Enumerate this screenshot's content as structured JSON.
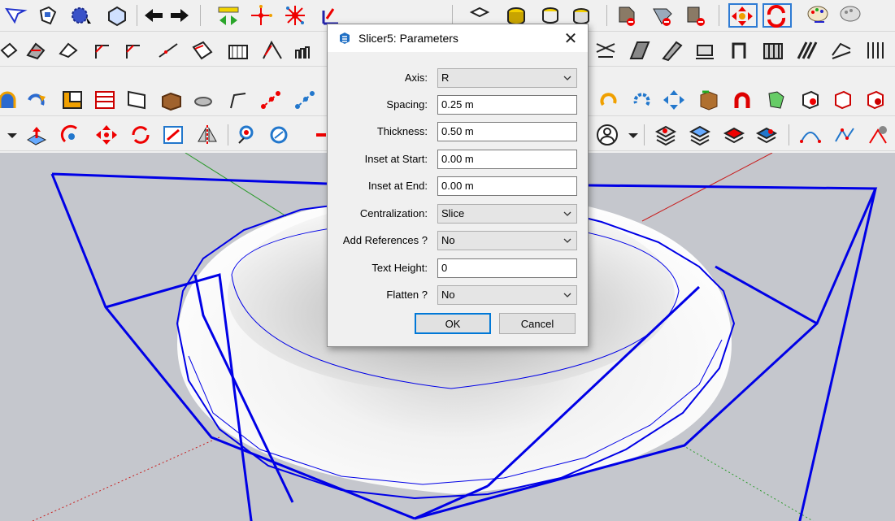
{
  "dialog": {
    "title": "Slicer5: Parameters",
    "close_glyph": "✕",
    "fields": {
      "axis": {
        "label": "Axis:",
        "value": "R"
      },
      "spacing": {
        "label": "Spacing:",
        "value": "0.25 m"
      },
      "thickness": {
        "label": "Thickness:",
        "value": "0.50 m"
      },
      "inset_start": {
        "label": "Inset at Start:",
        "value": "0.00 m"
      },
      "inset_end": {
        "label": "Inset at End:",
        "value": "0.00 m"
      },
      "centralization": {
        "label": "Centralization:",
        "value": "Slice"
      },
      "add_references": {
        "label": "Add References ?",
        "value": "No"
      },
      "text_height": {
        "label": "Text Height:",
        "value": "0"
      },
      "flatten": {
        "label": "Flatten ?",
        "value": "No"
      }
    },
    "ok_label": "OK",
    "cancel_label": "Cancel"
  },
  "colors": {
    "accent": "#0078d7",
    "wire": "#0000e6",
    "viewport": "#c5c7cd",
    "toolbar": "#f0f0f0"
  },
  "toolbar_icons": [
    [
      "select-icon",
      "component-icon",
      "paint-icon",
      "eraser-icon",
      "previous-view-icon",
      "next-view-icon",
      "tape-measure-icon",
      "axes-icon",
      "pan-icon",
      "orbit-icon",
      "zoom-icon",
      "zoom-window-icon",
      "cube-icon",
      "layer-icon",
      "section-icon",
      "hide-icon",
      "style-icon",
      "material-icon",
      "reset-icon",
      "palette-icon",
      "sandbox-icon"
    ],
    [
      "line-icon",
      "arc-icon",
      "rectangle-icon",
      "circle-icon",
      "polygon-icon",
      "freehand-icon",
      "offset-icon",
      "follow-me-icon",
      "curve-icon",
      "stair-icon",
      "profile-icon",
      "wall-icon"
    ],
    [
      "push-pull-icon",
      "rotate-icon",
      "move-icon",
      "scale-icon",
      "flip-icon",
      "array-icon",
      "weld-icon",
      "split-icon",
      "spiral-icon",
      "chain-icon",
      "undo-icon",
      "redo-icon",
      "copy-icon",
      "paste-icon"
    ],
    [
      "dropdown-icon",
      "extrude-icon",
      "twist-icon",
      "move-arrows-icon",
      "rotate-arrows-icon",
      "scale-box-icon",
      "mirror-icon",
      "pin-icon",
      "balloon-icon",
      "user-icon",
      "stack-icon",
      "terrain-icon",
      "surface-icon",
      "wave-icon"
    ]
  ]
}
